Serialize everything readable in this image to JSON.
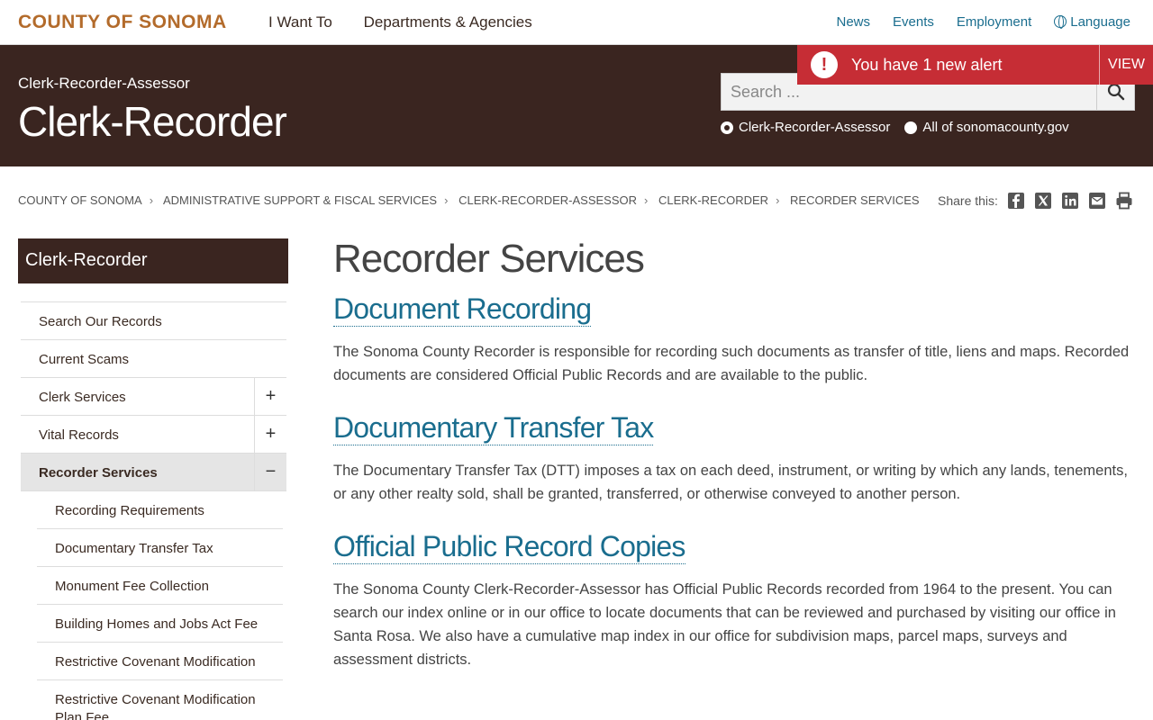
{
  "topnav": {
    "brand": "COUNTY OF SONOMA",
    "main_links": [
      "I Want To",
      "Departments & Agencies"
    ],
    "util_links": [
      "News",
      "Events",
      "Employment",
      "Language"
    ]
  },
  "header": {
    "department": "Clerk-Recorder-Assessor",
    "site_title": "Clerk-Recorder",
    "search_placeholder": "Search ...",
    "radio_options": [
      {
        "label": "Clerk-Recorder-Assessor",
        "checked": true
      },
      {
        "label": "All of sonomacounty.gov",
        "checked": false
      }
    ]
  },
  "alert": {
    "icon": "!",
    "text": "You have 1 new alert",
    "view_label": "VIEW"
  },
  "breadcrumb": [
    "COUNTY OF SONOMA",
    "ADMINISTRATIVE SUPPORT & FISCAL SERVICES",
    "CLERK-RECORDER-ASSESSOR",
    "CLERK-RECORDER",
    "RECORDER SERVICES"
  ],
  "share": {
    "label": "Share this:"
  },
  "sidebar": {
    "title": "Clerk-Recorder",
    "items": [
      {
        "label": "Search Our Records"
      },
      {
        "label": "Current Scams"
      },
      {
        "label": "Clerk Services",
        "toggle": "+"
      },
      {
        "label": "Vital Records",
        "toggle": "+"
      },
      {
        "label": "Recorder Services",
        "toggle": "−",
        "active": true
      }
    ],
    "subitems": [
      {
        "label": "Recording Requirements"
      },
      {
        "label": "Documentary Transfer Tax"
      },
      {
        "label": "Monument Fee Collection"
      },
      {
        "label": "Building Homes and Jobs Act Fee"
      },
      {
        "label": "Restrictive Covenant Modification"
      },
      {
        "label": "Restrictive Covenant Modification Plan Fee"
      }
    ]
  },
  "main": {
    "title": "Recorder Services",
    "sections": [
      {
        "heading": "Document Recording",
        "text": "The Sonoma County Recorder is responsible for recording such documents as transfer of title, liens and maps. Recorded documents are considered Official Public Records and are available to the public."
      },
      {
        "heading": "Documentary Transfer Tax",
        "text": "The Documentary Transfer Tax (DTT) imposes a tax on each deed, instrument, or writing by which any lands, tenements, or any other realty sold, shall be granted, transferred, or otherwise conveyed to another person."
      },
      {
        "heading": "Official Public Record Copies",
        "text": "The Sonoma County Clerk-Recorder-Assessor has Official Public Records recorded from 1964 to the present. You can search our index online or in our office to locate documents that can be reviewed and purchased by visiting our office in Santa Rosa. We also have a cumulative map index in our office for subdivision maps, parcel maps, surveys and assessment districts."
      }
    ]
  },
  "colors": {
    "brand_orange": "#b36b2b",
    "header_brown": "#3a2520",
    "link_blue": "#1a6d8e",
    "alert_red": "#c62d35"
  }
}
